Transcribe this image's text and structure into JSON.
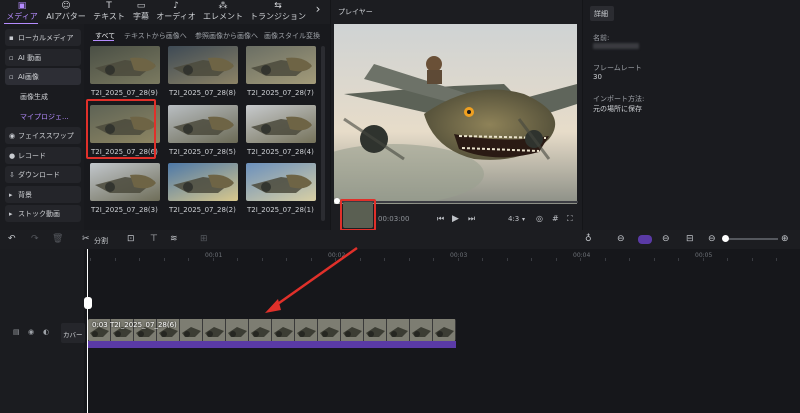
{
  "toolbar": {
    "items": [
      {
        "label": "メディア",
        "icon": "folder-icon"
      },
      {
        "label": "AIアバター",
        "icon": "avatar-icon"
      },
      {
        "label": "テキスト",
        "icon": "text-icon"
      },
      {
        "label": "字幕",
        "icon": "caption-icon"
      },
      {
        "label": "オーディオ",
        "icon": "music-icon"
      },
      {
        "label": "エレメント",
        "icon": "elements-icon"
      },
      {
        "label": "トランジション",
        "icon": "transition-icon"
      }
    ],
    "more": "›"
  },
  "sidebar": {
    "items": [
      {
        "label": "ローカルメディア"
      },
      {
        "label": "AI 動画"
      },
      {
        "label": "AI画像"
      },
      {
        "label": "画像生成"
      },
      {
        "label": "マイプロジェ..."
      },
      {
        "label": "フェイススワップ"
      },
      {
        "label": "レコード"
      },
      {
        "label": "ダウンロード"
      },
      {
        "label": "背景"
      },
      {
        "label": "ストック動画"
      }
    ]
  },
  "media": {
    "tabs": [
      "すべて",
      "テキストから画像へ",
      "参照画像から画像へ",
      "画像スタイル変換"
    ],
    "thumbnails": [
      {
        "label": "T2I_2025_07_28(9)"
      },
      {
        "label": "T2I_2025_07_28(8)"
      },
      {
        "label": "T2I_2025_07_28(7)"
      },
      {
        "label": "T2I_2025_07_28(6)"
      },
      {
        "label": "T2I_2025_07_28(5)"
      },
      {
        "label": "T2I_2025_07_28(4)"
      },
      {
        "label": "T2I_2025_07_28(3)"
      },
      {
        "label": "T2I_2025_07_28(2)"
      },
      {
        "label": "T2I_2025_07_28(1)"
      }
    ]
  },
  "player": {
    "title": "プレイヤー",
    "time": "00:03:00",
    "ratio": "4:3"
  },
  "details": {
    "tab": "詳細",
    "name_label": "名前:",
    "framerate_label": "フレームレート",
    "framerate_value": "30",
    "import_label": "インポート方法:",
    "import_value": "元の場所に保存"
  },
  "timeline": {
    "split_label": "分割",
    "ruler": [
      "00:01",
      "00:02",
      "00:03",
      "00:04",
      "00:05"
    ],
    "clip_title": "0:03 T2I_2025_07_28(6)",
    "cover_label": "カバー"
  }
}
